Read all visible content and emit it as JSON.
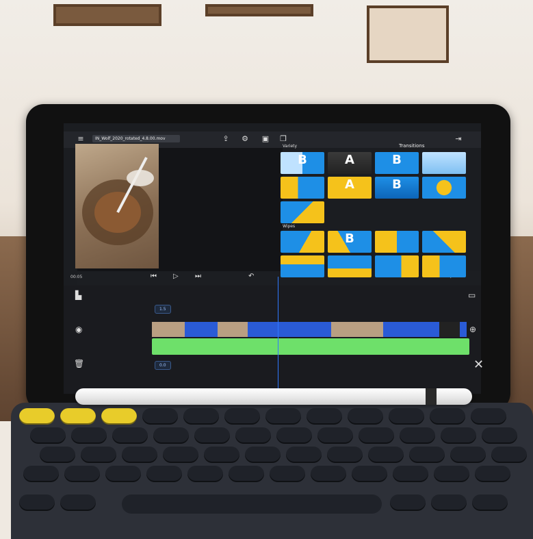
{
  "app": {
    "project_name": "IN_Wolf_2020_rotated_4.8.00.mov",
    "panel_title": "Transitions",
    "timecode": "00:05",
    "section_variety": "Variety",
    "section_wipes": "Wipes",
    "track_label_top": "1.5",
    "track_label_bottom": "0.0"
  },
  "colors": {
    "accent_blue": "#2f79ff",
    "tile_blue": "#1e8fe6",
    "tile_yellow": "#f5c21b",
    "audio_green": "#6ee06a",
    "clip_blue": "#2a5bd6",
    "key_yellow": "#e8cc2a"
  },
  "transition_tiles_variety": [
    {
      "glyph": "B",
      "style": "blue-split"
    },
    {
      "glyph": "A",
      "style": "dark-A"
    },
    {
      "glyph": "B",
      "style": "blue-full"
    },
    {
      "glyph": "",
      "style": "light-blue"
    },
    {
      "glyph": "",
      "style": "yellow-blue"
    },
    {
      "glyph": "A",
      "style": "yellow-A"
    },
    {
      "glyph": "B",
      "style": "blue-B"
    },
    {
      "glyph": "",
      "style": "blue-yellow-box"
    },
    {
      "glyph": "",
      "style": "blue-yellow-diag"
    }
  ],
  "transition_tiles_wipes": [
    {
      "glyph": "",
      "style": "wipe-1"
    },
    {
      "glyph": "B",
      "style": "wipe-2"
    },
    {
      "glyph": "",
      "style": "wipe-3"
    },
    {
      "glyph": "",
      "style": "wipe-4"
    },
    {
      "glyph": "",
      "style": "wipe-5"
    },
    {
      "glyph": "",
      "style": "wipe-6"
    },
    {
      "glyph": "",
      "style": "wipe-7"
    },
    {
      "glyph": "",
      "style": "wipe-8"
    }
  ],
  "icons": [
    "menu-icon",
    "share-icon",
    "settings-icon",
    "media-icon",
    "export-icon",
    "play-icon",
    "previous-icon",
    "next-icon",
    "undo-icon",
    "zoom-icon",
    "audio-meter-icon",
    "layers-icon",
    "delete-icon",
    "close-icon",
    "add-icon"
  ]
}
